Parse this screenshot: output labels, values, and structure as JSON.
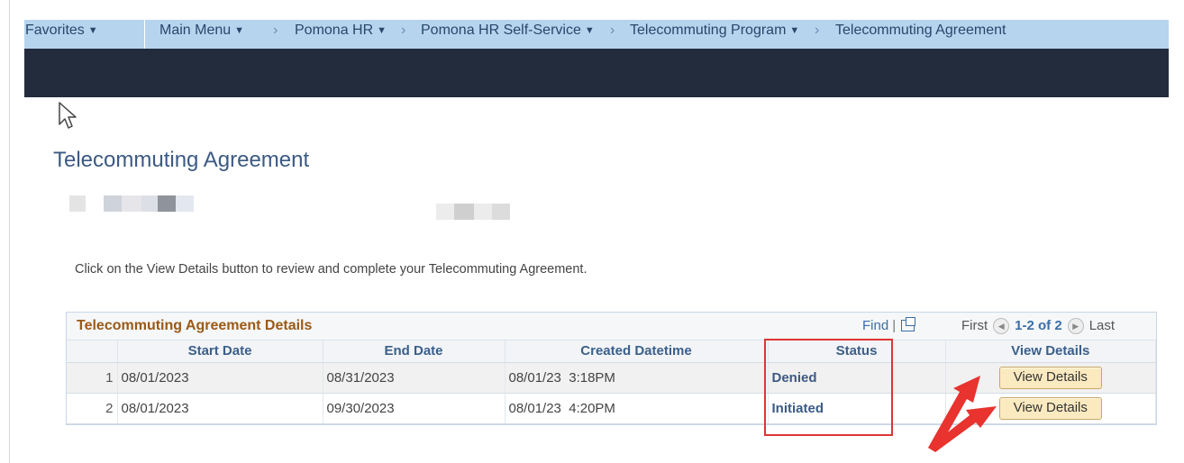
{
  "nav": {
    "favorites": "Favorites",
    "main_menu": "Main Menu",
    "crumbs": [
      "Pomona HR",
      "Pomona HR Self-Service",
      "Telecommuting Program",
      "Telecommuting Agreement"
    ]
  },
  "page_title": "Telecommuting Agreement",
  "instructions": "Click on the View Details button to review and complete your Telecommuting Agreement.",
  "grid": {
    "title": "Telecommuting Agreement Details",
    "find": "Find",
    "pager": {
      "first": "First",
      "range": "1-2 of 2",
      "last": "Last"
    },
    "columns": [
      "Start Date",
      "End Date",
      "Created Datetime",
      "Status",
      "View Details"
    ],
    "rows": [
      {
        "num": "1",
        "start": "08/01/2023",
        "end": "08/31/2023",
        "created": "08/01/23  3:18PM",
        "status": "Denied",
        "button": "View Details"
      },
      {
        "num": "2",
        "start": "08/01/2023",
        "end": "09/30/2023",
        "created": "08/01/23  4:20PM",
        "status": "Initiated",
        "button": "View Details"
      }
    ]
  },
  "colors": {
    "nav_bg": "#b7d4ef",
    "dark_bar": "#232c3c",
    "accent_title": "#9a5a16",
    "highlight": "#e03434",
    "button_bg": "#fbeac0"
  }
}
